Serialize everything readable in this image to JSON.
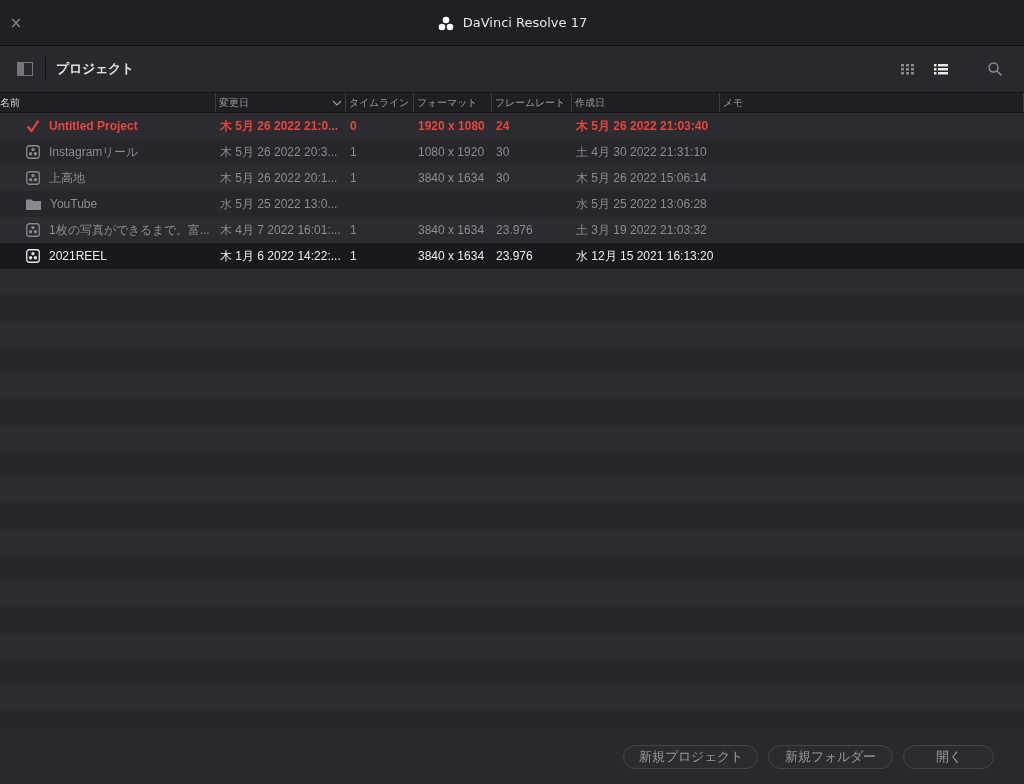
{
  "window": {
    "title": "DaVinci Resolve 17",
    "close": "×"
  },
  "toolbar": {
    "title": "プロジェクト",
    "views": [
      {
        "selected": false
      },
      {
        "selected": true
      }
    ]
  },
  "table": {
    "columns": [
      {
        "label": "名前",
        "sorted": false
      },
      {
        "label": "変更日",
        "sorted": true
      },
      {
        "label": "タイムライン",
        "sorted": false
      },
      {
        "label": "フォーマット",
        "sorted": false
      },
      {
        "label": "フレームレート",
        "sorted": false
      },
      {
        "label": "作成日",
        "sorted": false
      },
      {
        "label": "メモ",
        "sorted": false
      }
    ],
    "rows": [
      {
        "kind": "current",
        "selected": false,
        "cells": [
          "Untitled Project",
          "木 5月 26 2022 21:0...",
          "0",
          "1920 x 1080",
          "24",
          "木 5月 26 2022 21:03:40"
        ]
      },
      {
        "kind": "project",
        "selected": false,
        "cells": [
          "Instagramリール",
          "木 5月 26 2022 20:3...",
          "1",
          "1080 x 1920",
          "30",
          "土 4月 30 2022 21:31:10"
        ]
      },
      {
        "kind": "project",
        "selected": false,
        "cells": [
          "上高地",
          "木 5月 26 2022 20:1...",
          "1",
          "3840 x 1634",
          "30",
          "木 5月 26 2022 15:06:14"
        ]
      },
      {
        "kind": "folder",
        "selected": false,
        "cells": [
          "YouTube",
          "水 5月 25 2022 13:0...",
          "",
          "",
          "",
          "水 5月 25 2022 13:06:28"
        ]
      },
      {
        "kind": "project",
        "selected": false,
        "cells": [
          "1枚の写真ができるまで。富...",
          "木 4月 7 2022 16:01:...",
          "1",
          "3840 x 1634",
          "23.976",
          "土 3月 19 2022 21:03:32"
        ]
      },
      {
        "kind": "project",
        "selected": true,
        "cells": [
          "2021REEL",
          "木 1月 6 2022 14:22:...",
          "1",
          "3840 x 1634",
          "23.976",
          "水 12月 15 2021 16:13:20"
        ]
      }
    ]
  },
  "buttons": [
    "新規プロジェクト",
    "新規フォルダー",
    "開く"
  ]
}
